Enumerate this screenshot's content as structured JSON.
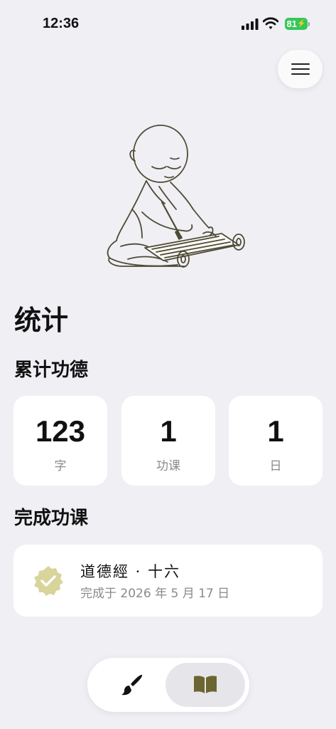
{
  "status_bar": {
    "time": "12:36",
    "battery_level": "81"
  },
  "icons": {
    "menu": "hamburger-menu-icon",
    "illustration": "monk-writing-scroll-illustration",
    "completed": "check-badge-icon",
    "tab_write": "brush-icon",
    "tab_read": "open-book-icon"
  },
  "colors": {
    "background": "#f0eff4",
    "card": "#ffffff",
    "check_badge": "#d8d49a",
    "book_tab_icon": "#6b6531",
    "battery": "#35c759"
  },
  "page": {
    "title": "统计"
  },
  "merit": {
    "heading": "累计功德",
    "stats": [
      {
        "value": "123",
        "label": "字"
      },
      {
        "value": "1",
        "label": "功课"
      },
      {
        "value": "1",
        "label": "日"
      }
    ]
  },
  "completed": {
    "heading": "完成功课",
    "items": [
      {
        "title": "道德經 · 十六",
        "date": "完成于 2026 年 5 月 17 日"
      }
    ]
  },
  "tab_bar": {
    "selected": "read"
  }
}
